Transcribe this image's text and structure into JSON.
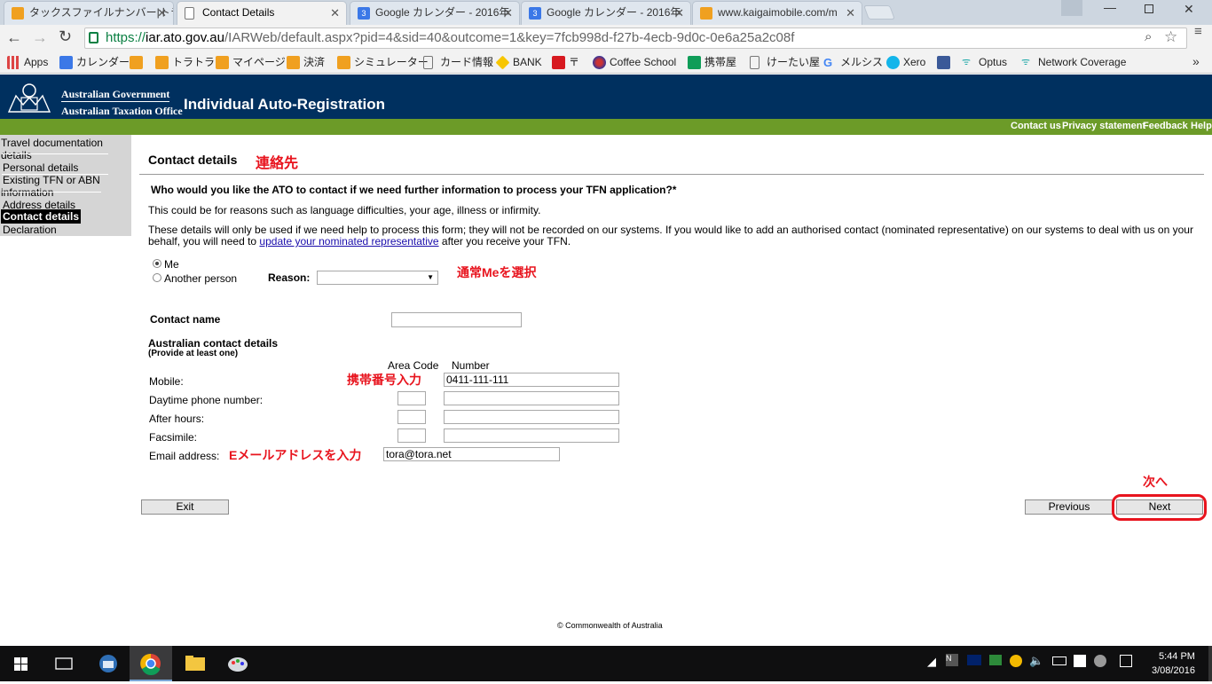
{
  "browser": {
    "tabs": [
      {
        "label": "タックスファイルナンバー|トラト",
        "active": false
      },
      {
        "label": "Contact Details",
        "active": true
      },
      {
        "label": "Google カレンダー - 2016年",
        "active": false
      },
      {
        "label": "Google カレンダー - 2016年",
        "active": false
      },
      {
        "label": "www.kaigaimobile.com/m",
        "active": false
      }
    ],
    "url_scheme": "https://",
    "url_host": "iar.ato.gov.au",
    "url_path": "/IARWeb/default.aspx?pid=4&sid=40&outcome=1&key=7fcb998d-f27b-4ecb-9d0c-0e6a25a2c08f",
    "bookmarks": [
      {
        "label": "Apps",
        "icon": "apps-grid-icon"
      },
      {
        "label": "カレンダー",
        "icon": "calendar-icon"
      },
      {
        "label": "",
        "icon": "tiger-icon"
      },
      {
        "label": "トラトラ",
        "icon": "tiger-icon"
      },
      {
        "label": "マイページ",
        "icon": "tiger-icon"
      },
      {
        "label": "決済",
        "icon": "tiger-icon"
      },
      {
        "label": "シミュレーター",
        "icon": "tiger-icon"
      },
      {
        "label": "カード情報",
        "icon": "page-icon"
      },
      {
        "label": "BANK",
        "icon": "diamond-icon"
      },
      {
        "label": "〒",
        "icon": "post-icon"
      },
      {
        "label": "Coffee School",
        "icon": "globe-icon"
      },
      {
        "label": "携帯屋",
        "icon": "sheet-icon"
      },
      {
        "label": "けーたい屋",
        "icon": "page-icon"
      },
      {
        "label": "メルシス",
        "icon": "google-icon"
      },
      {
        "label": "Xero",
        "icon": "xero-icon"
      },
      {
        "label": "",
        "icon": "facebook-icon"
      },
      {
        "label": "Optus",
        "icon": "optus-icon"
      },
      {
        "label": "Network Coverage",
        "icon": "optus-icon"
      }
    ],
    "more_bookmarks": "»"
  },
  "site": {
    "gov_line1": "Australian Government",
    "gov_line2": "Australian Taxation Office",
    "app_title": "Individual Auto-Registration",
    "util_links": [
      "Contact us",
      "Privacy statement",
      "Feedback",
      "Help"
    ]
  },
  "sidebar": {
    "items": [
      {
        "label": "Travel documentation details",
        "active": false
      },
      {
        "label": "Personal details",
        "active": false
      },
      {
        "label": "Existing TFN or ABN information",
        "active": false
      },
      {
        "label": "Address details",
        "active": false
      },
      {
        "label": "Contact details",
        "active": true
      },
      {
        "label": "Declaration",
        "active": false
      }
    ]
  },
  "form": {
    "heading": "Contact details",
    "question": "Who would you like the ATO to contact if we need further information to process your TFN application?*",
    "info1": "This could be for reasons such as language difficulties, your age, illness or infirmity.",
    "info2_before": "These details will only be used if we need help to process this form; they will not be recorded on our systems. If you would like to add an authorised contact (nominated representative) on our systems to deal with us on your behalf, you will need to ",
    "info2_link": "update your nominated representative",
    "info2_after": " after you receive your TFN.",
    "radio_me": "Me",
    "radio_other": "Another person",
    "reason_label": "Reason:",
    "reason_value": "",
    "contact_name_label": "Contact name",
    "contact_name_value": "",
    "aus_contact_title": "Australian contact details",
    "aus_contact_sub": "(Provide at least one)",
    "col_area": "Area Code",
    "col_number": "Number",
    "mobile_label": "Mobile:",
    "mobile_value": "0411-111-111",
    "daytime_label": "Daytime phone number:",
    "afterhours_label": "After hours:",
    "fax_label": "Facsimile:",
    "email_label": "Email address:",
    "email_value": "tora@tora.net",
    "exit_label": "Exit",
    "previous_label": "Previous",
    "next_label": "Next"
  },
  "annotations": {
    "heading_jp": "連絡先",
    "me_jp": "通常Meを選択",
    "mobile_jp": "携帯番号入力",
    "email_jp": "Eメールアドレスを入力",
    "next_jp": "次へ",
    "color": "#e8141e"
  },
  "footer": {
    "copyright": "© Commonwealth of Australia"
  },
  "taskbar": {
    "time": "5:44 PM",
    "date": "3/08/2016"
  }
}
